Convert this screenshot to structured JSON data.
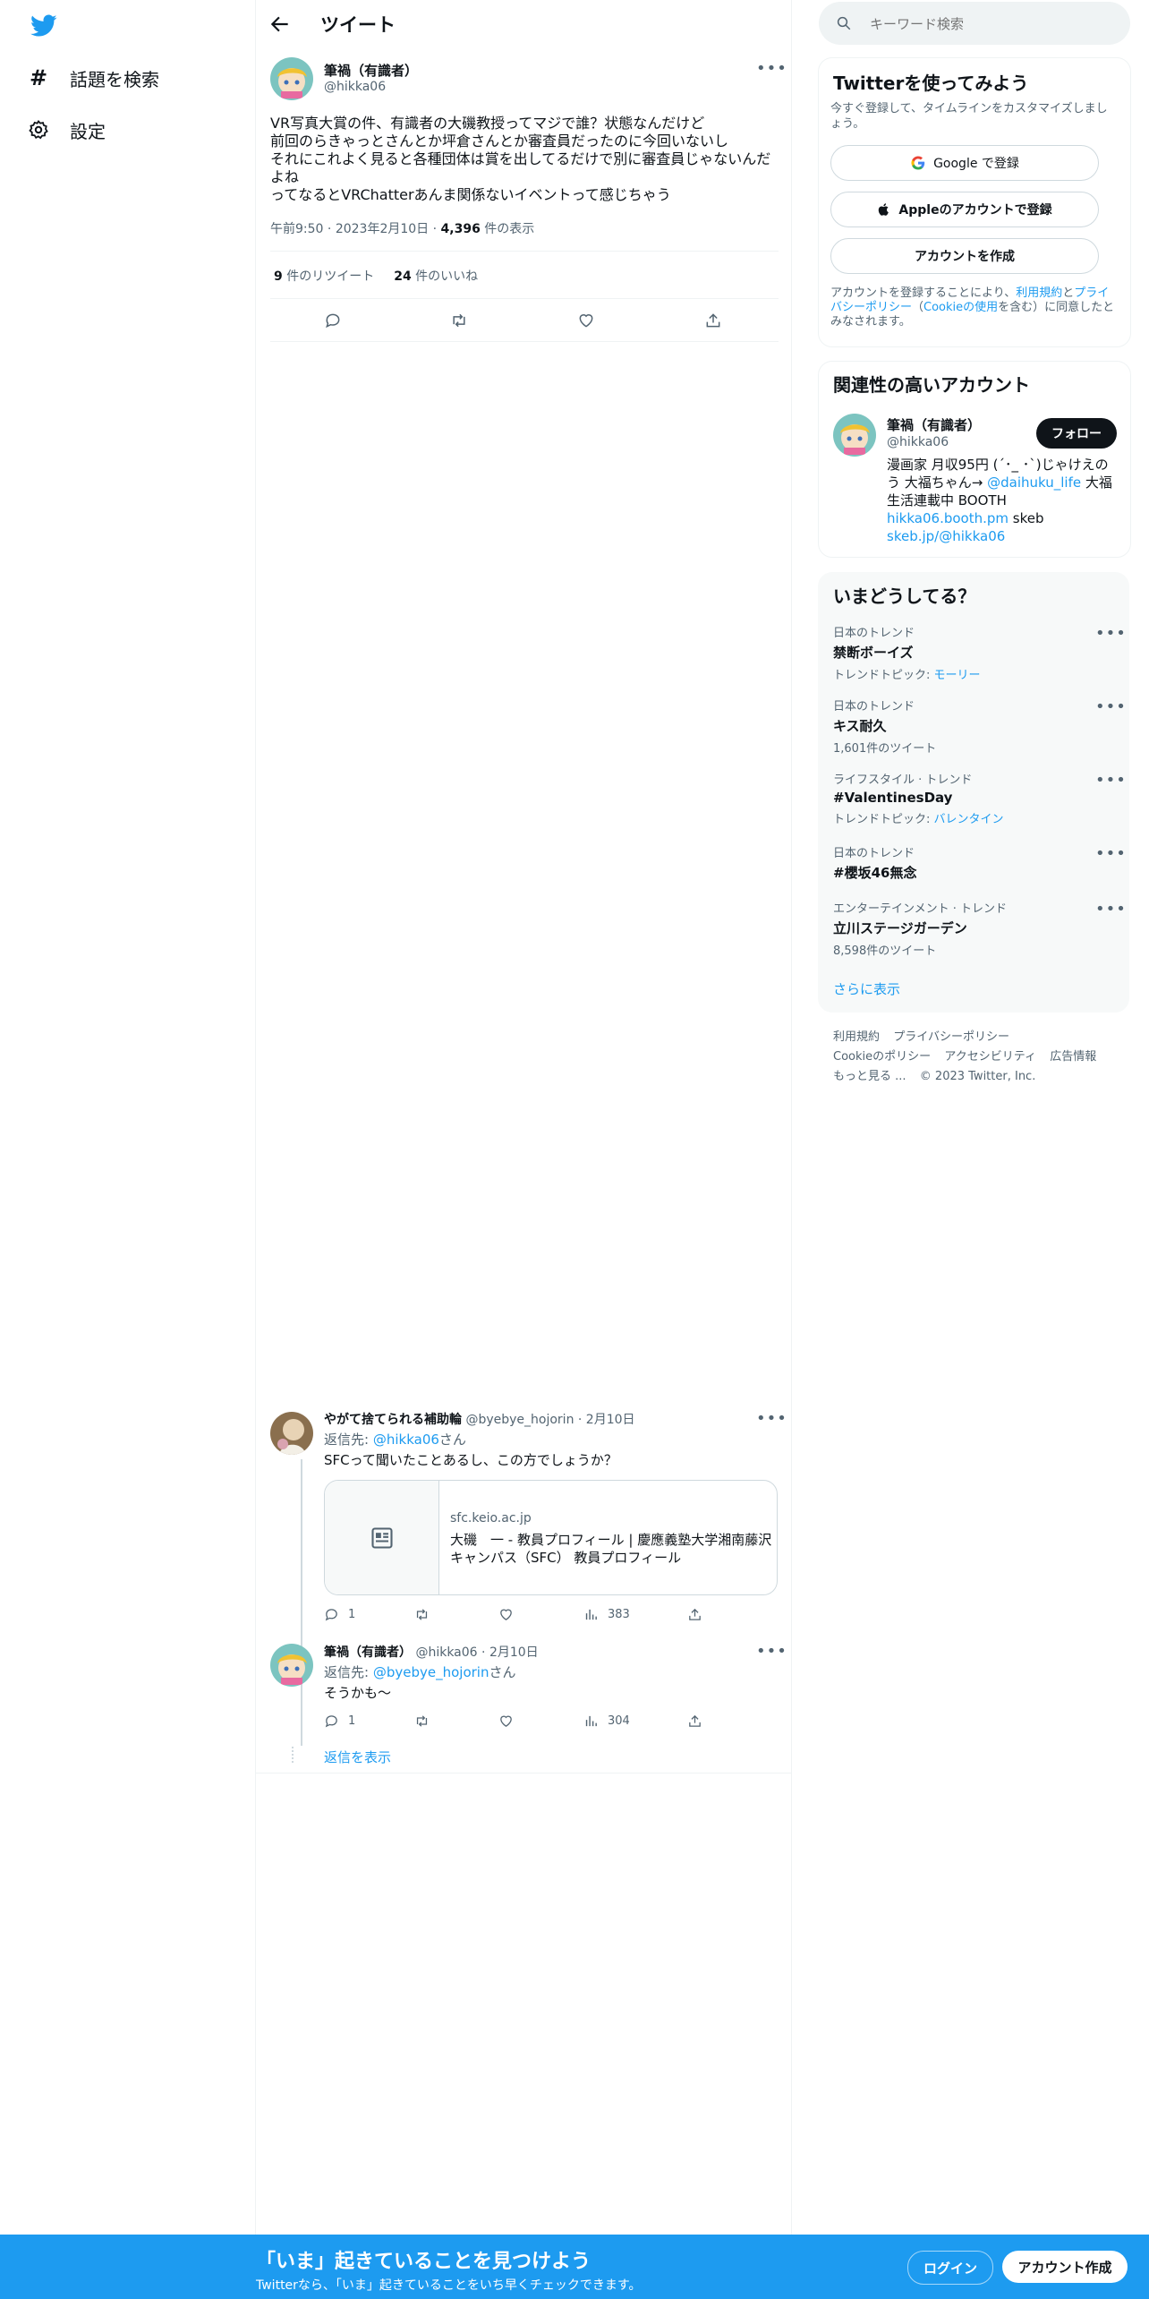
{
  "nav": {
    "explore_label": "話題を検索",
    "settings_label": "設定"
  },
  "header": {
    "title": "ツイート"
  },
  "tweet": {
    "author_name": "筆禍（有識者）",
    "author_handle": "@hikka06",
    "text": "VR写真大賞の件、有識者の大磯教授ってマジで誰？状態なんだけど\n前回のらきゃっとさんとか坪倉さんとか審査員だったのに今回いないし\nそれにこれよく見ると各種団体は賞を出してるだけで別に審査員じゃないんだよね\nってなるとVRChatterあんま関係ないイベントって感じちゃう",
    "time": "午前9:50",
    "date": "2023年2月10日",
    "views_count": "4,396",
    "views_label": "件の表示",
    "retweets_count": "9",
    "retweets_label": "件のリツイート",
    "likes_count": "24",
    "likes_label": "件のいいね"
  },
  "replies": [
    {
      "author_name": "やがて捨てられる補助輪",
      "author_handle": "@byebye_hojorin",
      "date": "2月10日",
      "reply_to_label": "返信先:",
      "reply_to_handle": "@hikka06",
      "reply_to_suffix": "さん",
      "text": "SFCって聞いたことあるし、この方でしょうか？",
      "card_domain": "sfc.keio.ac.jp",
      "card_title": "大磯　一 - 教員プロフィール | 慶應義塾大学湘南藤沢キャンパス（SFC） 教員プロフィール",
      "reply_count": "1",
      "views": "383"
    },
    {
      "author_name": "筆禍（有識者）",
      "author_handle": "@hikka06",
      "date": "2月10日",
      "reply_to_label": "返信先:",
      "reply_to_handle": "@byebye_hojorin",
      "reply_to_suffix": "さん",
      "text": "そうかも～",
      "reply_count": "1",
      "views": "304"
    }
  ],
  "show_replies_label": "返信を表示",
  "search": {
    "placeholder": "キーワード検索"
  },
  "signup": {
    "title": "Twitterを使ってみよう",
    "subtitle": "今すぐ登録して、タイムラインをカスタマイズしましょう。",
    "google_label": "Google で登録",
    "apple_label": "Appleのアカウントで登録",
    "create_label": "アカウントを作成",
    "legal_prefix": "アカウントを登録することにより、",
    "legal_terms": "利用規約",
    "legal_and": "と",
    "legal_privacy": "プライバシーポリシー",
    "legal_open": "（",
    "legal_cookie": "Cookieの使用",
    "legal_suffix": "を含む）に同意したとみなされます。"
  },
  "relevant": {
    "title": "関連性の高いアカウント",
    "name": "筆禍（有識者）",
    "handle": "@hikka06",
    "follow_label": "フォロー",
    "bio_1": "漫画家 月収95円 (´･_ ･`)じゃけえのう 大福ちゃん→ ",
    "bio_link1": "@daihuku_life",
    "bio_2": " 大福生活連載中 BOOTH ",
    "bio_link2": "hikka06.booth.pm",
    "bio_3": " skeb ",
    "bio_link3": "skeb.jp/@hikka06"
  },
  "trends": {
    "title": "いまどうしてる？",
    "items": [
      {
        "category": "日本のトレンド",
        "name": "禁断ボーイズ",
        "sub_prefix": "トレンドトピック: ",
        "sub_link": "モーリー",
        "sub": ""
      },
      {
        "category": "日本のトレンド",
        "name": "キス耐久",
        "sub_prefix": "",
        "sub_link": "",
        "sub": "1,601件のツイート"
      },
      {
        "category": "ライフスタイル · トレンド",
        "name": "#ValentinesDay",
        "sub_prefix": "トレンドトピック: ",
        "sub_link": "バレンタイン",
        "sub": ""
      },
      {
        "category": "日本のトレンド",
        "name": "#櫻坂46無念",
        "sub_prefix": "",
        "sub_link": "",
        "sub": ""
      },
      {
        "category": "エンターテインメント · トレンド",
        "name": "立川ステージガーデン",
        "sub_prefix": "",
        "sub_link": "",
        "sub": "8,598件のツイート"
      }
    ],
    "show_more_label": "さらに表示"
  },
  "footer": {
    "terms": "利用規約",
    "privacy": "プライバシーポリシー",
    "cookie": "Cookieのポリシー",
    "accessibility": "アクセシビリティ",
    "ads": "広告情報",
    "more": "もっと見る ...",
    "copyright": "© 2023 Twitter, Inc."
  },
  "banner": {
    "title": "「いま」起きていることを見つけよう",
    "subtitle": "Twitterなら、「いま」起きていることをいち早くチェックできます。",
    "login_label": "ログイン",
    "signup_label": "アカウント作成"
  },
  "colors": {
    "accent": "#1d9bf0",
    "text": "#0f1419",
    "muted": "#536471",
    "border": "#eff3f4"
  }
}
